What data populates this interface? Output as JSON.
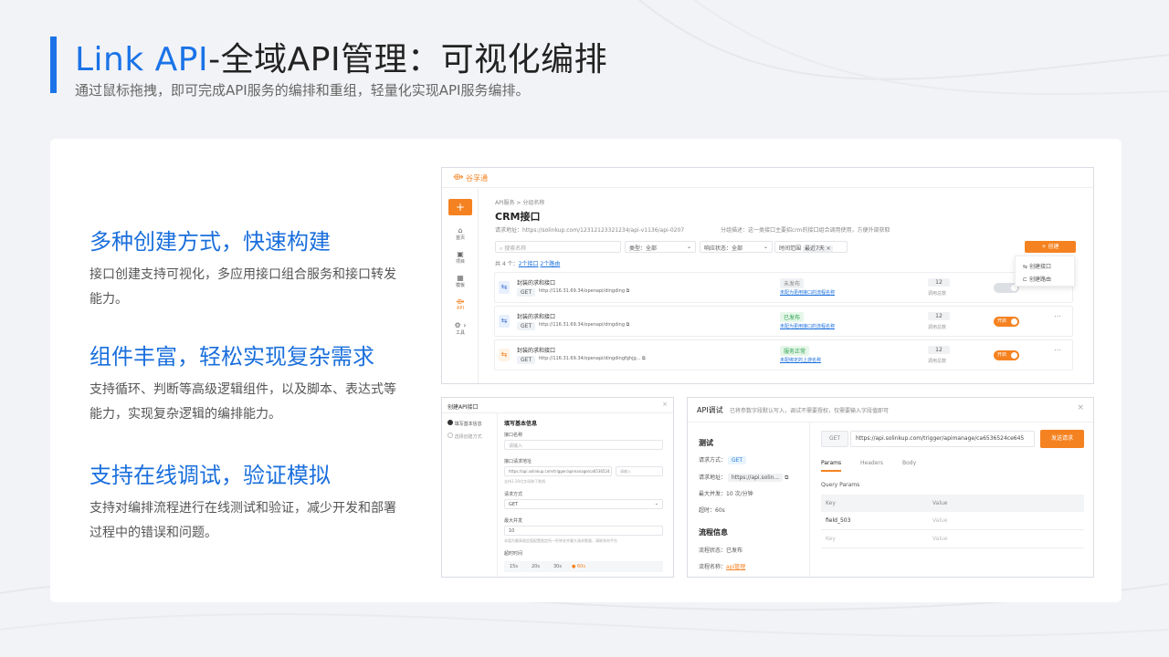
{
  "header": {
    "title_blue": "Link API",
    "title_rest": "-全域API管理：可视化编排",
    "subtitle": "通过鼠标拖拽，即可完成API服务的编排和重组，轻量化实现API服务编排。"
  },
  "features": [
    {
      "title": "多种创建方式，快速构建",
      "desc": "接口创建支持可视化，多应用接口组合服务和接口转发能力。"
    },
    {
      "title": "组件丰富，轻松实现复杂需求",
      "desc": "支持循环、判断等高级逻辑组件，以及脚本、表达式等能力，实现复杂逻辑的编排能力。"
    },
    {
      "title": "支持在线调试，验证模拟",
      "desc": "支持对编排流程进行在线测试和验证，减少开发和部署过程中的错误和问题。"
    }
  ],
  "shot_main": {
    "brand": "谷孚通",
    "add_btn": "+",
    "sidebar": [
      {
        "icon": "home-icon",
        "label": "首页"
      },
      {
        "icon": "project-icon",
        "label": "项目"
      },
      {
        "icon": "template-icon",
        "label": "模板"
      },
      {
        "icon": "api-icon",
        "label": "API"
      },
      {
        "icon": "tools-icon",
        "label": "工具"
      }
    ],
    "breadcrumb": "API服务 > 分组名称",
    "page_title": "CRM接口",
    "request_url": "请求地址：https://solinkup.com/12312123321234/api-v1136/api-0207",
    "group_desc": "分组描述：这一类接口主要招crm的接口组合调用使用，方便外部获取",
    "search_placeholder": "搜索名称",
    "filter_type": "类型：全部",
    "filter_status": "响应状态：全部",
    "filter_time_label": "时间范围",
    "filter_time_value": "最近7天 ×",
    "create_btn": "+ 创建",
    "count_text": "共 4 个：",
    "count_link1": "2个接口",
    "count_link2": "2个路由",
    "dropdown": [
      "创建接口",
      "创建路由"
    ],
    "rows": [
      {
        "name": "封装的求和接口",
        "method": "GET",
        "url": "http://116.31.69.34/openapi/dingding",
        "status": "未发布",
        "flow": "未配为更用接口的流程名称",
        "count": "12",
        "count_label": "调用总数",
        "toggle": ""
      },
      {
        "name": "封装的求和接口",
        "method": "GET",
        "url": "http://116.31.69.34/openapi/dingding",
        "status": "已发布",
        "flow": "未配为更用接口的流程名称",
        "count": "12",
        "count_label": "调用总数",
        "toggle": "开启"
      },
      {
        "name": "封装的求和接口",
        "method": "GET",
        "url": "http://116.31.69.34/openapi/dingdingfghjg...",
        "status": "服务正常",
        "flow": "未配绑定的上游名称",
        "count": "12",
        "count_label": "调用总数",
        "toggle": "开启"
      }
    ]
  },
  "shot_create": {
    "title": "创建API接口",
    "steps": [
      "填写基本信息",
      "选择创建方式"
    ],
    "section": "填写基本信息",
    "field_name": "接口名称",
    "field_name_ph": "请输入",
    "field_url": "接口请求地址",
    "field_url_value": "https://api.solinkup.com/trigger/apimanage/ca6536524...",
    "field_url_ph": "请输入",
    "field_url_hint": "支持1-20位字母和下划线",
    "field_method": "请求方式",
    "field_method_value": "GET",
    "field_concurrency": "最大并发",
    "field_concurrency_value": "10",
    "field_concurrency_hint": "本值为最高限定值配置限定所一秒钟发并最大请求数量，请联系你平台",
    "field_timeout": "超时时间",
    "timeouts": [
      "15s",
      "20s",
      "30s",
      "60s"
    ]
  },
  "shot_debug": {
    "title": "API调试",
    "hint": "已将参数字段默认写入，调试不需要授权，仅需要输入字段值即可",
    "test_label": "测试",
    "method_label": "请求方式：",
    "method_value": "GET",
    "url_label": "请求地址：",
    "url_value": "https://api.solin...",
    "concurrency": "最大并发：10 次/分钟",
    "timeout": "超时：60s",
    "flow_label": "流程信息",
    "flow_status": "流程状态：已发布",
    "flow_name_label": "流程名称：",
    "flow_name_link": "api管理",
    "req_method": "GET",
    "req_url": "https://api.solinkup.com/trigger/apimanage/ca6536524ce645",
    "send_btn": "发送请求",
    "tabs": [
      "Params",
      "Headers",
      "Body"
    ],
    "query_params": "Query Params",
    "col_key": "Key",
    "col_value": "Value",
    "param_rows": [
      {
        "key": "field_503",
        "value": "Value"
      },
      {
        "key": "Key",
        "value": "Value"
      }
    ]
  }
}
